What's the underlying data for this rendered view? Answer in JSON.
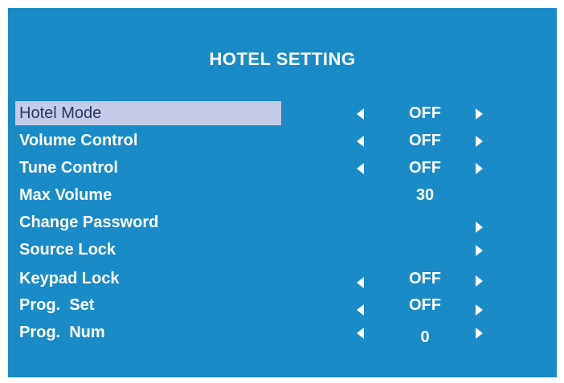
{
  "menu": {
    "title": "HOTEL SETTING",
    "items": [
      {
        "label": "Hotel Mode",
        "value": "OFF",
        "left_arrow": true,
        "right_arrow": true,
        "selected": true
      },
      {
        "label": "Volume Control",
        "value": "OFF",
        "left_arrow": true,
        "right_arrow": true,
        "selected": false
      },
      {
        "label": "Tune Control",
        "value": "OFF",
        "left_arrow": true,
        "right_arrow": true,
        "selected": false
      },
      {
        "label": "Max Volume",
        "value": "30",
        "left_arrow": false,
        "right_arrow": false,
        "selected": false
      },
      {
        "label": "Change Password",
        "value": "",
        "left_arrow": false,
        "right_arrow": true,
        "selected": false
      },
      {
        "label": "Source Lock",
        "value": "",
        "left_arrow": false,
        "right_arrow": true,
        "selected": false
      },
      {
        "label": "Keypad Lock",
        "value": "OFF",
        "left_arrow": true,
        "right_arrow": true,
        "selected": false
      },
      {
        "label": "Prog.  Set",
        "value": "OFF",
        "left_arrow": true,
        "right_arrow": true,
        "selected": false
      },
      {
        "label": "Prog.  Num",
        "value": "0",
        "left_arrow": true,
        "right_arrow": true,
        "selected": false
      }
    ]
  },
  "colors": {
    "background": "#1a8bc7",
    "highlight": "#c3cbe6",
    "text": "#ffffff"
  }
}
